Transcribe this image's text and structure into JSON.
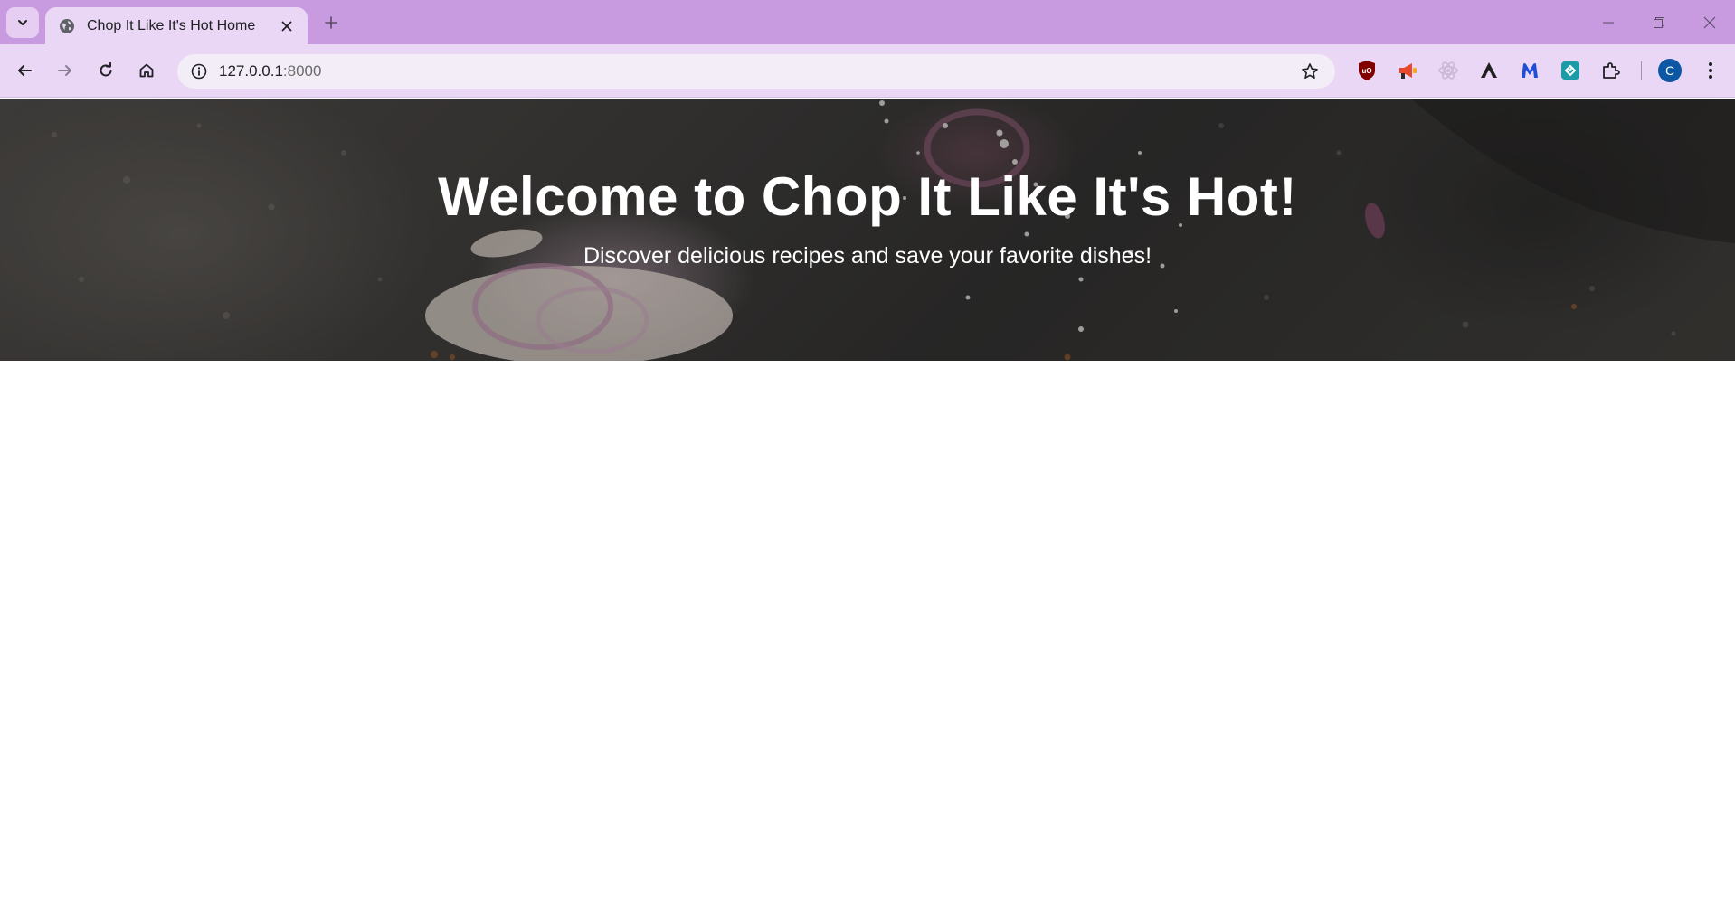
{
  "browser": {
    "tab": {
      "title": "Chop It Like It's Hot Home"
    },
    "address_bar": {
      "host": "127.0.0.1",
      "port": ":8000"
    },
    "profile_initial": "C",
    "theme_color": "#c89be0"
  },
  "page": {
    "hero": {
      "title": "Welcome to Chop It Like It's Hot!",
      "subtitle": "Discover delicious recipes and save your favorite dishes!"
    }
  }
}
